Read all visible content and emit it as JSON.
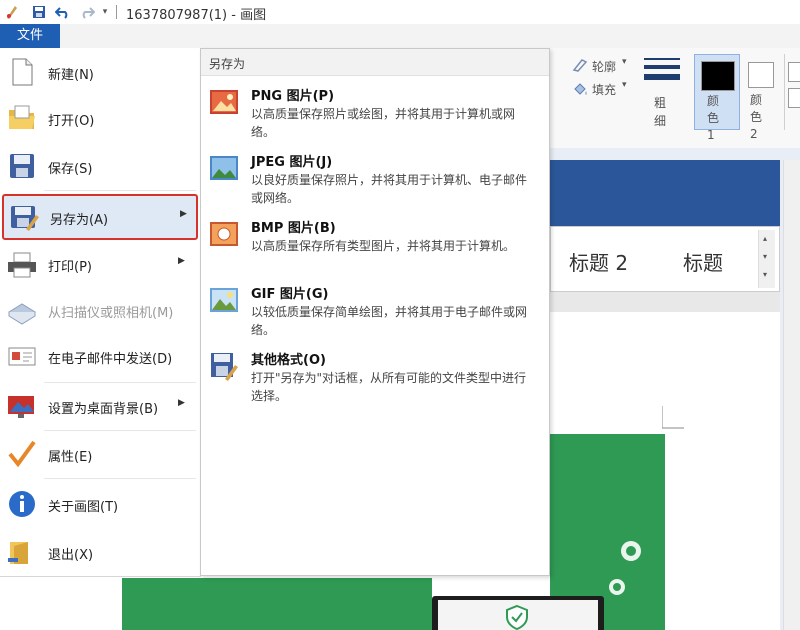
{
  "titlebar": {
    "title": "1637807987(1) - 画图"
  },
  "file_tab": {
    "label": "文件"
  },
  "ribbon": {
    "outline_label": "轮廓",
    "fill_label": "填充",
    "thickness_label": "粗细",
    "color1_label": "颜色 1",
    "color2_label": "颜色 2",
    "color1": "#000000",
    "color2": "#ffffff"
  },
  "document": {
    "styles": [
      "标题 2",
      "标题"
    ],
    "accent": "#2b579a"
  },
  "file_menu": {
    "items": [
      {
        "label": "新建(N)"
      },
      {
        "label": "打开(O)"
      },
      {
        "label": "保存(S)"
      },
      {
        "label": "另存为(A)"
      },
      {
        "label": "打印(P)"
      },
      {
        "label": "从扫描仪或照相机(M)"
      },
      {
        "label": "在电子邮件中发送(D)"
      },
      {
        "label": "设置为桌面背景(B)"
      },
      {
        "label": "属性(E)"
      },
      {
        "label": "关于画图(T)"
      },
      {
        "label": "退出(X)"
      }
    ]
  },
  "submenu": {
    "header": "另存为",
    "items": [
      {
        "title": "PNG 图片(P)",
        "desc": "以高质量保存照片或绘图，并将其用于计算机或网络。",
        "icon": "png-image-icon"
      },
      {
        "title": "JPEG 图片(J)",
        "desc": "以良好质量保存照片，并将其用于计算机、电子邮件或网络。",
        "icon": "jpeg-image-icon"
      },
      {
        "title": "BMP 图片(B)",
        "desc": "以高质量保存所有类型图片，并将其用于计算机。",
        "icon": "bmp-image-icon"
      },
      {
        "title": "GIF 图片(G)",
        "desc": "以较低质量保存简单绘图，并将其用于电子邮件或网络。",
        "icon": "gif-image-icon"
      },
      {
        "title": "其他格式(O)",
        "desc": "打开\"另存为\"对话框，从所有可能的文件类型中进行选择。",
        "icon": "other-formats-icon"
      }
    ]
  },
  "colors": {
    "file_tab": "#1e5fb4",
    "highlight_border": "#d6322a",
    "highlight_bg": "#dfe8f5",
    "green": "#2e9a54"
  }
}
